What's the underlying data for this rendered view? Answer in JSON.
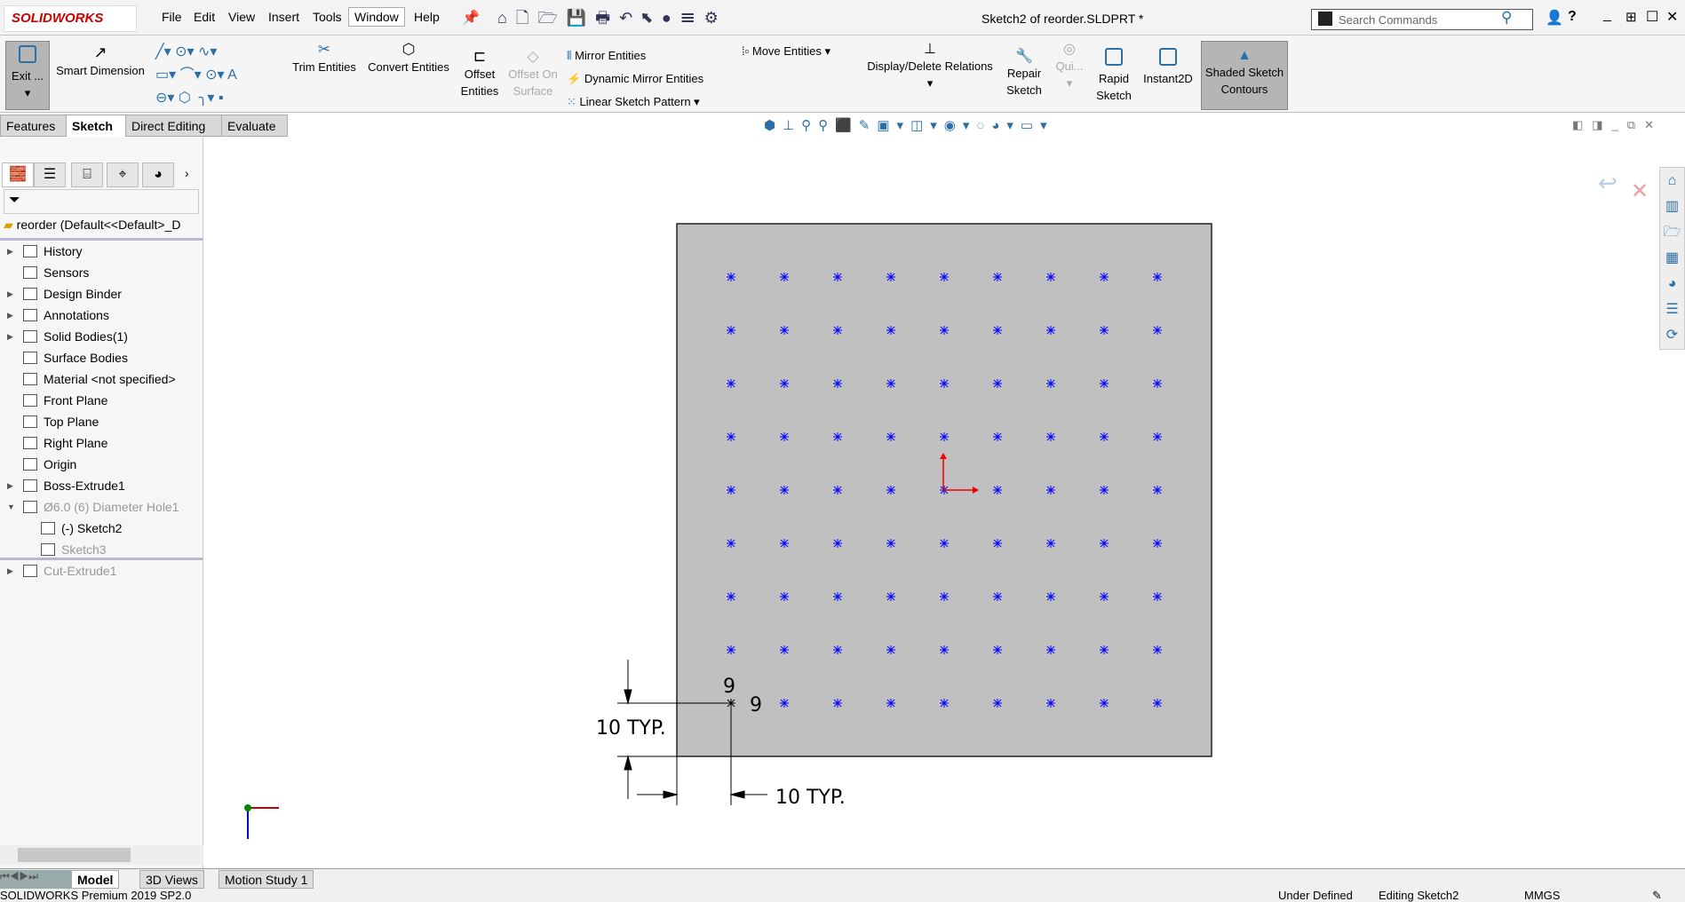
{
  "app": {
    "logo": "SOLIDWORKS",
    "title": "Sketch2 of reorder.SLDPRT *"
  },
  "menu": [
    "File",
    "Edit",
    "View",
    "Insert",
    "Tools",
    "Window",
    "Help"
  ],
  "search": {
    "placeholder": "Search Commands"
  },
  "ribbon": {
    "exit": "Exit ...",
    "smart_dimension": "Smart Dimension",
    "trim": "Trim Entities",
    "convert": "Convert Entities",
    "offset": "Offset Entities",
    "offset_surface": "Offset On Surface",
    "mirror": "Mirror Entities",
    "dynamic_mirror": "Dynamic Mirror Entities",
    "linear_pattern": "Linear Sketch Pattern",
    "move": "Move Entities",
    "relations": "Display/Delete Relations",
    "repair": "Repair Sketch",
    "quick": "Qui...",
    "rapid": "Rapid Sketch",
    "instant2d": "Instant2D",
    "shaded": "Shaded Sketch Contours"
  },
  "tabs": [
    "Features",
    "Sketch",
    "Direct Editing",
    "Evaluate"
  ],
  "feature_tree": {
    "root": "reorder  (Default<<Default>_D",
    "items": [
      {
        "label": "History",
        "expand": true,
        "dim": false
      },
      {
        "label": "Sensors",
        "expand": false,
        "dim": false
      },
      {
        "label": "Design Binder",
        "expand": true,
        "dim": false
      },
      {
        "label": "Annotations",
        "expand": true,
        "dim": false
      },
      {
        "label": "Solid Bodies(1)",
        "expand": true,
        "dim": false
      },
      {
        "label": "Surface Bodies",
        "expand": false,
        "dim": false
      },
      {
        "label": "Material <not specified>",
        "expand": false,
        "dim": false
      },
      {
        "label": "Front Plane",
        "expand": false,
        "dim": false
      },
      {
        "label": "Top Plane",
        "expand": false,
        "dim": false
      },
      {
        "label": "Right Plane",
        "expand": false,
        "dim": false
      },
      {
        "label": "Origin",
        "expand": false,
        "dim": false
      },
      {
        "label": "Boss-Extrude1",
        "expand": true,
        "dim": false
      },
      {
        "label": "Ø6.0 (6) Diameter Hole1",
        "expand": true,
        "dim": true
      },
      {
        "label": "(-) Sketch2",
        "expand": false,
        "dim": false,
        "indent": true
      },
      {
        "label": "Sketch3",
        "expand": false,
        "dim": true,
        "indent": true
      },
      {
        "label": "Cut-Extrude1",
        "expand": true,
        "dim": true
      }
    ]
  },
  "sketch": {
    "rows": 9,
    "cols": 9,
    "row_count_label": "9",
    "col_count_label": "9",
    "dim_v": "10 TYP.",
    "dim_h": "10 TYP.",
    "point_color": "#0000ff",
    "face_color": "#c0c0c0"
  },
  "bottom_tabs": [
    "Model",
    "3D Views",
    "Motion Study 1"
  ],
  "status": {
    "product": "SOLIDWORKS Premium 2019 SP2.0",
    "state": "Under Defined",
    "mode": "Editing Sketch2",
    "units": "MMGS"
  }
}
